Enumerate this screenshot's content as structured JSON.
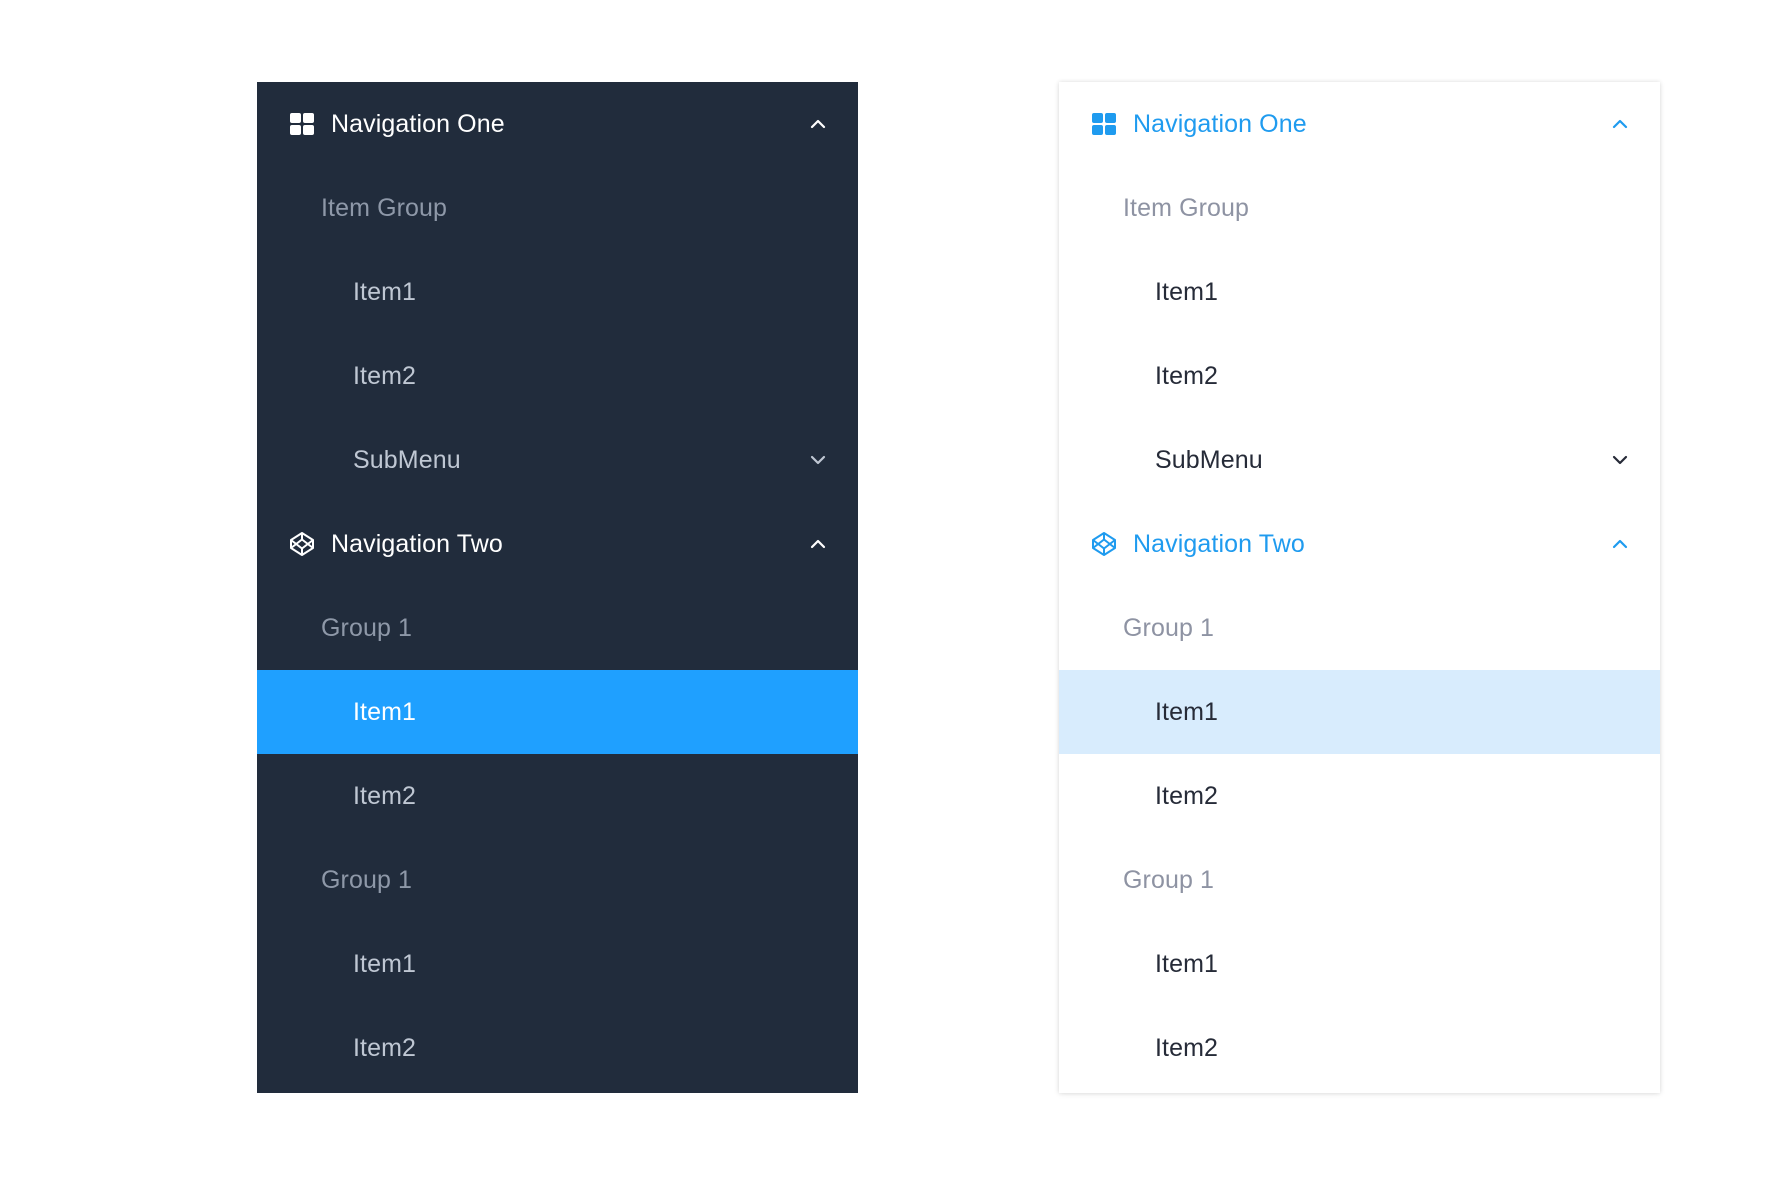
{
  "colors": {
    "dark_bg": "#212c3c",
    "selected_dark": "#1fa0ff",
    "selected_light": "#d8ecfd",
    "accent": "#1f9bef"
  },
  "menu": {
    "nav_one": {
      "label": "Navigation One",
      "icon": "grid-icon",
      "group_label": "Item Group",
      "items": [
        "Item1",
        "Item2"
      ],
      "submenu_label": "SubMenu"
    },
    "nav_two": {
      "label": "Navigation Two",
      "icon": "codepen-icon",
      "groups": [
        {
          "label": "Group 1",
          "items": [
            "Item1",
            "Item2"
          ]
        },
        {
          "label": "Group 1",
          "items": [
            "Item1",
            "Item2"
          ]
        }
      ],
      "selected_item": "Item1"
    }
  }
}
